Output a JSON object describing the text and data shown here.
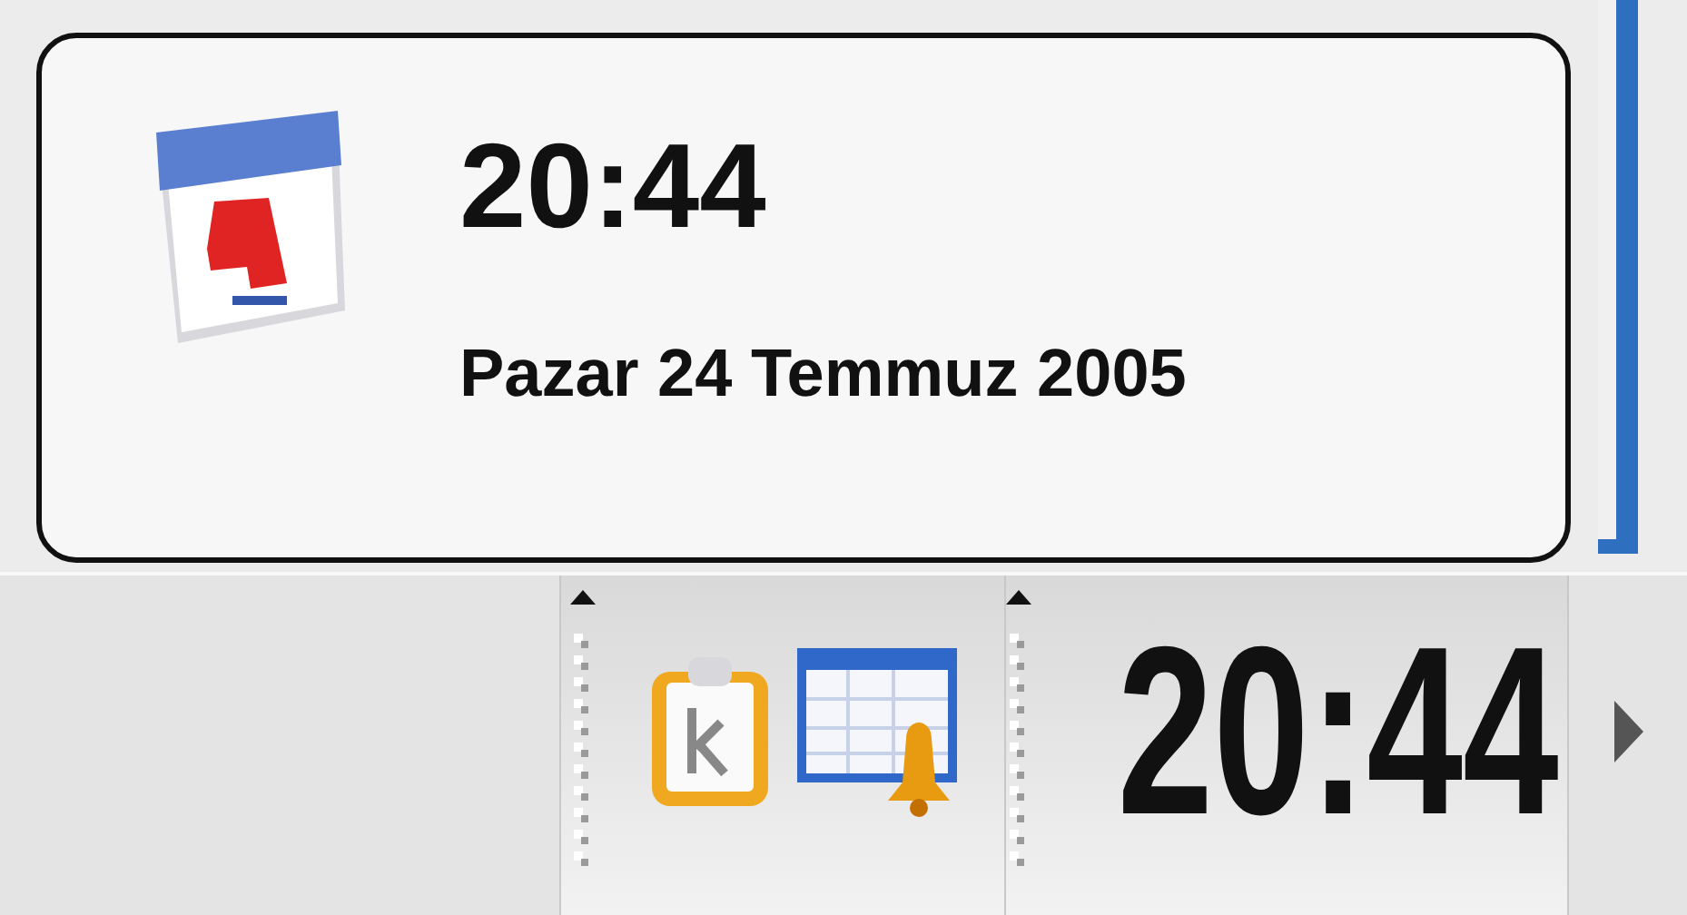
{
  "tooltip": {
    "time": "20:44",
    "date": "Pazar 24 Temmuz 2005"
  },
  "panel": {
    "clock": {
      "time": "20:44"
    }
  }
}
